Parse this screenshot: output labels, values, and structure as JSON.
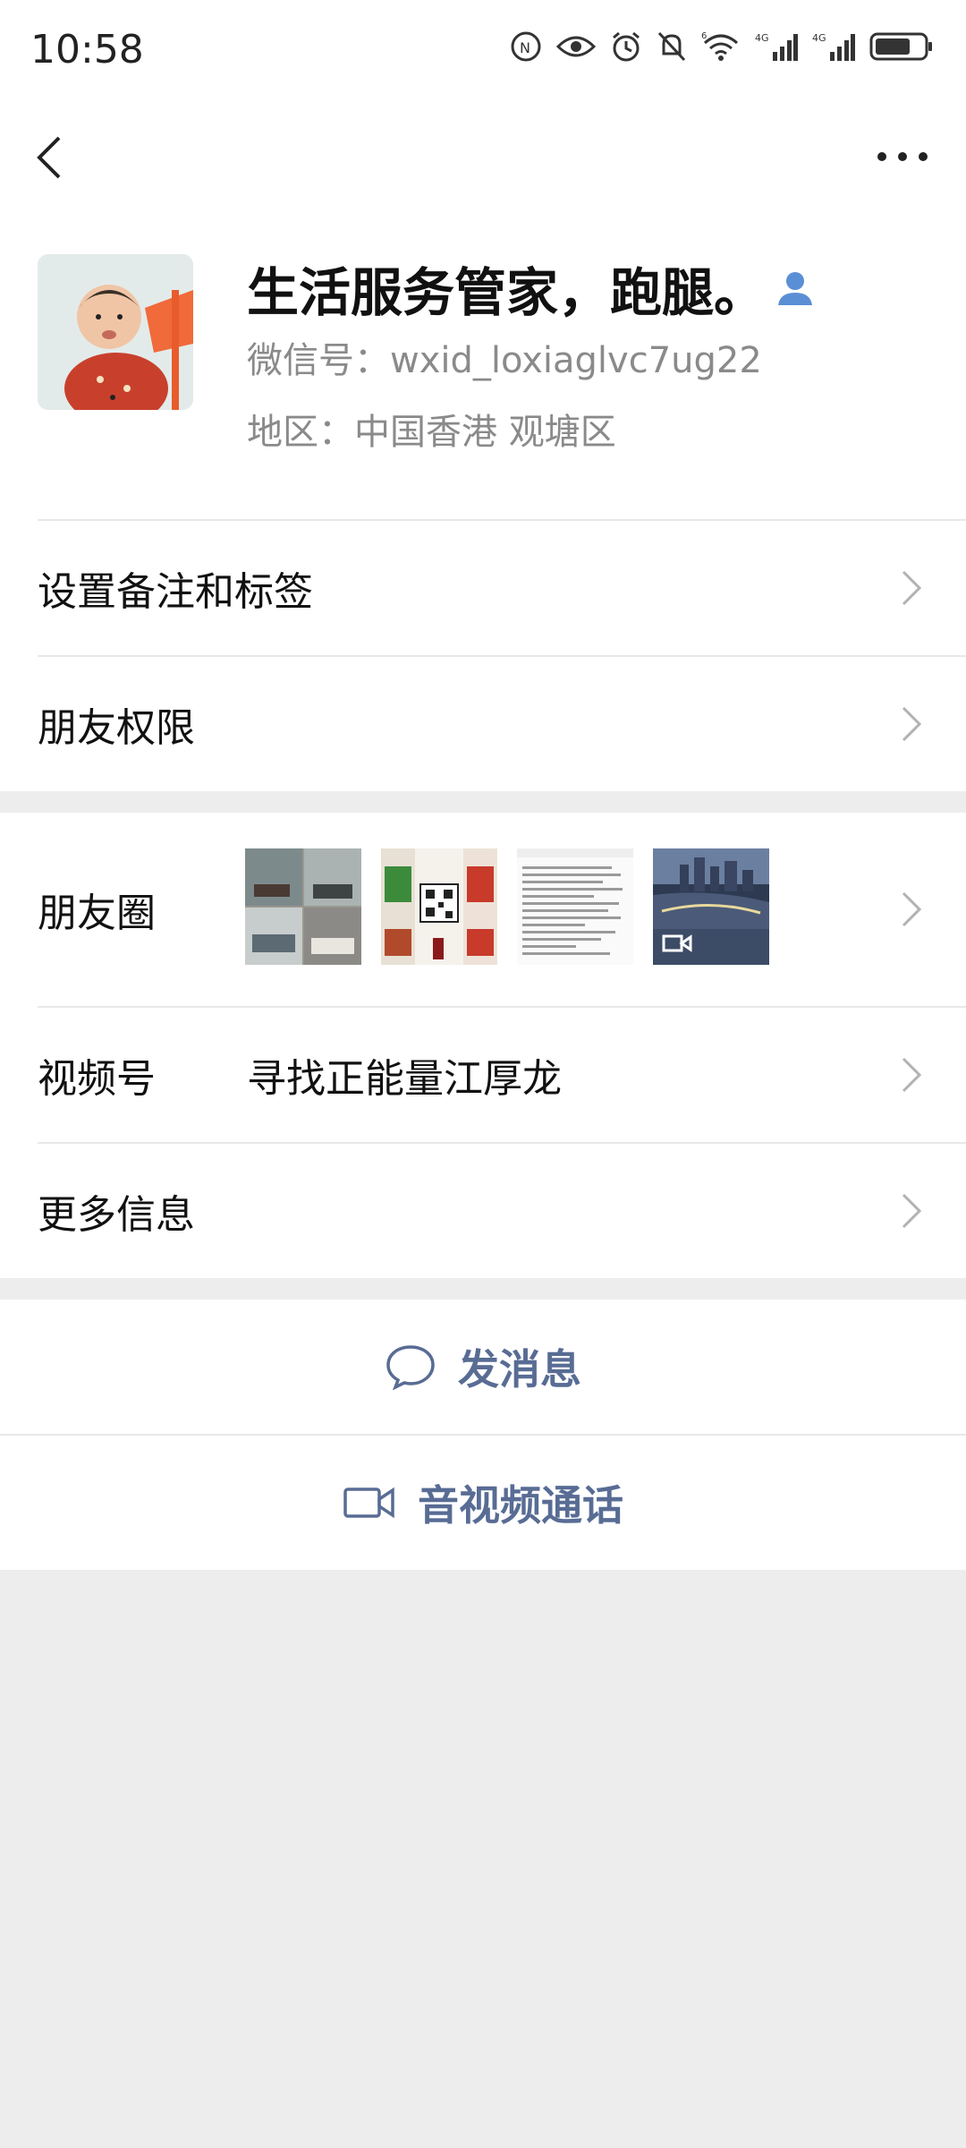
{
  "status_bar": {
    "time": "10:58",
    "icons": [
      "nfc-icon",
      "eye-icon",
      "alarm-icon",
      "mute-icon",
      "wifi-icon",
      "signal-4g-icon",
      "signal-4g-icon",
      "battery-icon"
    ],
    "wifi_label": "6",
    "network_1": "4G",
    "network_2": "4G"
  },
  "nav": {
    "back_icon": "back-chevron-icon",
    "more_icon": "more-dots-icon"
  },
  "profile": {
    "name": "生活服务管家，跑腿。",
    "wechat_id": "微信号：wxid_loxiaglvc7ug22",
    "region": "地区：中国香港  观塘区",
    "badge_icon": "friend-person-icon"
  },
  "menu": {
    "set_remark": "设置备注和标签",
    "friend_permissions": "朋友权限",
    "moments": "朋友圈",
    "channels": "视频号",
    "channels_value": "寻找正能量江厚龙",
    "more_info": "更多信息"
  },
  "actions": {
    "send_message": "发消息",
    "av_call": "音视频通话"
  },
  "colors": {
    "link_blue": "#586c94",
    "badge_blue": "#5a8fd6",
    "background": "#ededed"
  }
}
